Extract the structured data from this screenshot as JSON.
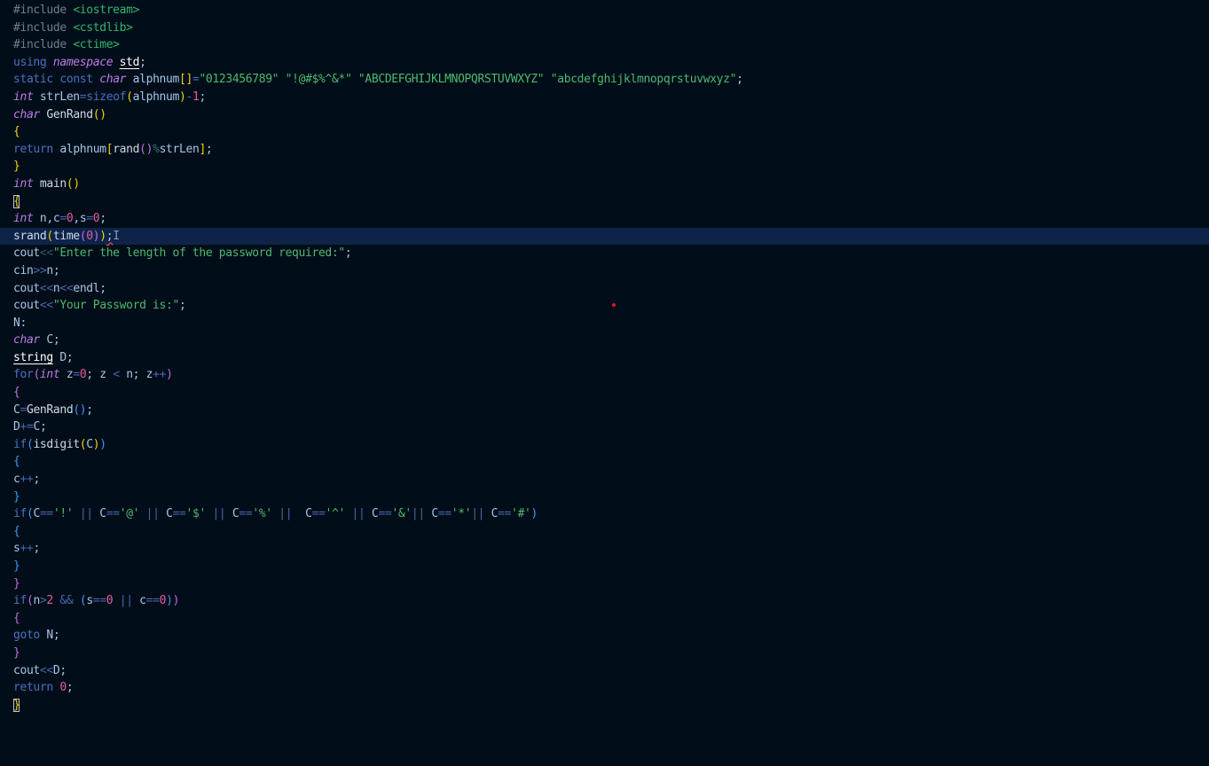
{
  "editor": {
    "current_line": 14,
    "lines": [
      [
        [
          "#include",
          "t-pp"
        ],
        [
          " ",
          ""
        ],
        [
          "<iostream>",
          "t-inc"
        ]
      ],
      [
        [
          "#include",
          "t-pp"
        ],
        [
          " ",
          ""
        ],
        [
          "<cstdlib>",
          "t-inc"
        ]
      ],
      [
        [
          "#include",
          "t-pp"
        ],
        [
          " ",
          ""
        ],
        [
          "<ctime>",
          "t-inc"
        ]
      ],
      [
        [
          "using",
          "t-kw"
        ],
        [
          " ",
          ""
        ],
        [
          "namespace",
          "t-type"
        ],
        [
          " ",
          ""
        ],
        [
          "std",
          "t-ul"
        ],
        [
          ";",
          "t-id"
        ]
      ],
      [
        [
          "static",
          "t-kw"
        ],
        [
          " ",
          ""
        ],
        [
          "const",
          "t-kw"
        ],
        [
          " ",
          ""
        ],
        [
          "char",
          "t-type"
        ],
        [
          " ",
          ""
        ],
        [
          "alphnum",
          "t-id"
        ],
        [
          "[]",
          "t-b1"
        ],
        [
          "=",
          "t-op"
        ],
        [
          "\"0123456789\"",
          "t-str"
        ],
        [
          " ",
          ""
        ],
        [
          "\"!@#$%^&*\"",
          "t-str"
        ],
        [
          " ",
          ""
        ],
        [
          "\"ABCDEFGHIJKLMNOPQRSTUVWXYZ\"",
          "t-str"
        ],
        [
          " ",
          ""
        ],
        [
          "\"abcdefghijklmnopqrstuvwxyz\"",
          "t-str"
        ],
        [
          ";",
          "t-id"
        ]
      ],
      [
        [
          "int",
          "t-type"
        ],
        [
          " ",
          ""
        ],
        [
          "strLen",
          "t-id"
        ],
        [
          "=",
          "t-op"
        ],
        [
          "sizeof",
          "t-kw"
        ],
        [
          "(",
          "t-b1"
        ],
        [
          "alphnum",
          "t-id"
        ],
        [
          ")",
          "t-b1"
        ],
        [
          "-",
          "t-op"
        ],
        [
          "1",
          "t-num"
        ],
        [
          ";",
          "t-id"
        ]
      ],
      [
        [
          "char",
          "t-type"
        ],
        [
          " ",
          ""
        ],
        [
          "GenRand",
          "t-fn"
        ],
        [
          "()",
          "t-b1"
        ]
      ],
      [
        [
          "{",
          "t-b1"
        ]
      ],
      [
        [
          "return",
          "t-kw"
        ],
        [
          " ",
          ""
        ],
        [
          "alphnum",
          "t-id"
        ],
        [
          "[",
          "t-b1"
        ],
        [
          "rand",
          "t-fn"
        ],
        [
          "()",
          "t-b2"
        ],
        [
          "%",
          "t-pct"
        ],
        [
          "strLen",
          "t-id"
        ],
        [
          "]",
          "t-b1"
        ],
        [
          ";",
          "t-id"
        ]
      ],
      [
        [
          "}",
          "t-b1"
        ]
      ],
      [
        [
          "int",
          "t-type"
        ],
        [
          " ",
          ""
        ],
        [
          "main",
          "t-fn"
        ],
        [
          "()",
          "t-b1"
        ]
      ],
      [
        [
          "{",
          "t-bm"
        ]
      ],
      [
        [
          "int",
          "t-type"
        ],
        [
          " ",
          ""
        ],
        [
          "n",
          "t-id"
        ],
        [
          ",",
          "t-id"
        ],
        [
          "c",
          "t-id"
        ],
        [
          "=",
          "t-op"
        ],
        [
          "0",
          "t-num"
        ],
        [
          ",",
          "t-id"
        ],
        [
          "s",
          "t-id"
        ],
        [
          "=",
          "t-op"
        ],
        [
          "0",
          "t-num"
        ],
        [
          ";",
          "t-id"
        ]
      ],
      [
        [
          "srand",
          "t-fn"
        ],
        [
          "(",
          "t-b1"
        ],
        [
          "time",
          "t-fn"
        ],
        [
          "(",
          "t-b2"
        ],
        [
          "0",
          "t-num"
        ],
        [
          ")",
          "t-b2"
        ],
        [
          ")",
          "t-b1"
        ],
        [
          ";",
          "t-id squiggle"
        ],
        [
          "I",
          "t-cursor"
        ]
      ],
      [
        [
          "cout",
          "t-id"
        ],
        [
          "<<",
          "t-dim"
        ],
        [
          "\"Enter the length of the password required:\"",
          "t-str"
        ],
        [
          ";",
          "t-id"
        ]
      ],
      [
        [
          "cin",
          "t-id"
        ],
        [
          ">>",
          "t-op"
        ],
        [
          "n",
          "t-id"
        ],
        [
          ";",
          "t-id"
        ]
      ],
      [
        [
          "cout",
          "t-id"
        ],
        [
          "<<",
          "t-op"
        ],
        [
          "n",
          "t-id"
        ],
        [
          "<<",
          "t-op"
        ],
        [
          "endl",
          "t-id"
        ],
        [
          ";",
          "t-id"
        ]
      ],
      [
        [
          "cout",
          "t-id"
        ],
        [
          "<<",
          "t-op"
        ],
        [
          "\"Your Password is:\"",
          "t-str"
        ],
        [
          ";",
          "t-id"
        ]
      ],
      [
        [
          "N",
          "t-id"
        ],
        [
          ":",
          "t-id"
        ]
      ],
      [
        [
          "char",
          "t-type"
        ],
        [
          " ",
          ""
        ],
        [
          "C",
          "t-id"
        ],
        [
          ";",
          "t-id"
        ]
      ],
      [
        [
          "string",
          "t-ul"
        ],
        [
          " ",
          ""
        ],
        [
          "D",
          "t-id"
        ],
        [
          ";",
          "t-id"
        ]
      ],
      [
        [
          "for",
          "t-kw"
        ],
        [
          "(",
          "t-b2"
        ],
        [
          "int",
          "t-type"
        ],
        [
          " ",
          ""
        ],
        [
          "z",
          "t-id"
        ],
        [
          "=",
          "t-op"
        ],
        [
          "0",
          "t-num"
        ],
        [
          "; ",
          "t-id"
        ],
        [
          "z",
          "t-id"
        ],
        [
          " < ",
          "t-op"
        ],
        [
          "n",
          "t-id"
        ],
        [
          "; ",
          "t-id"
        ],
        [
          "z",
          "t-id"
        ],
        [
          "++",
          "t-op"
        ],
        [
          ")",
          "t-b2"
        ]
      ],
      [
        [
          "{",
          "t-b2"
        ]
      ],
      [
        [
          "C",
          "t-id"
        ],
        [
          "=",
          "t-op"
        ],
        [
          "GenRand",
          "t-fn"
        ],
        [
          "()",
          "t-b3"
        ],
        [
          ";",
          "t-id"
        ]
      ],
      [
        [
          "D",
          "t-id"
        ],
        [
          "+=",
          "t-op"
        ],
        [
          "C",
          "t-id"
        ],
        [
          ";",
          "t-id"
        ]
      ],
      [
        [
          "if",
          "t-kw"
        ],
        [
          "(",
          "t-b3"
        ],
        [
          "isdigit",
          "t-fn"
        ],
        [
          "(",
          "t-b1"
        ],
        [
          "C",
          "t-id"
        ],
        [
          ")",
          "t-b1"
        ],
        [
          ")",
          "t-b3"
        ]
      ],
      [
        [
          "{",
          "t-b3"
        ]
      ],
      [
        [
          "c",
          "t-id"
        ],
        [
          "++",
          "t-op"
        ],
        [
          ";",
          "t-id"
        ]
      ],
      [
        [
          "}",
          "t-b3"
        ]
      ],
      [
        [
          "if",
          "t-kw"
        ],
        [
          "(",
          "t-b3"
        ],
        [
          "C",
          "t-id"
        ],
        [
          "==",
          "t-op"
        ],
        [
          "'!'",
          "t-str"
        ],
        [
          " || ",
          "t-op"
        ],
        [
          "C",
          "t-id"
        ],
        [
          "==",
          "t-op"
        ],
        [
          "'@'",
          "t-str"
        ],
        [
          " || ",
          "t-op"
        ],
        [
          "C",
          "t-id"
        ],
        [
          "==",
          "t-op"
        ],
        [
          "'$'",
          "t-str"
        ],
        [
          " || ",
          "t-op"
        ],
        [
          "C",
          "t-id"
        ],
        [
          "==",
          "t-op"
        ],
        [
          "'%'",
          "t-str"
        ],
        [
          " ||  ",
          "t-op"
        ],
        [
          "C",
          "t-id"
        ],
        [
          "==",
          "t-op"
        ],
        [
          "'^'",
          "t-str"
        ],
        [
          " || ",
          "t-op"
        ],
        [
          "C",
          "t-id"
        ],
        [
          "==",
          "t-op"
        ],
        [
          "'&'",
          "t-str"
        ],
        [
          "|| ",
          "t-op"
        ],
        [
          "C",
          "t-id"
        ],
        [
          "==",
          "t-op"
        ],
        [
          "'*'",
          "t-str"
        ],
        [
          "|| ",
          "t-op"
        ],
        [
          "C",
          "t-id"
        ],
        [
          "==",
          "t-op"
        ],
        [
          "'#'",
          "t-str"
        ],
        [
          ")",
          "t-b3"
        ]
      ],
      [
        [
          "{",
          "t-b3"
        ]
      ],
      [
        [
          "s",
          "t-id"
        ],
        [
          "++",
          "t-op"
        ],
        [
          ";",
          "t-id"
        ]
      ],
      [
        [
          "}",
          "t-b3"
        ]
      ],
      [
        [
          "}",
          "t-b2"
        ]
      ],
      [
        [
          "if",
          "t-kw"
        ],
        [
          "(",
          "t-b2"
        ],
        [
          "n",
          "t-id"
        ],
        [
          ">",
          "t-op"
        ],
        [
          "2",
          "t-num"
        ],
        [
          " && ",
          "t-op"
        ],
        [
          "(",
          "t-b3"
        ],
        [
          "s",
          "t-id"
        ],
        [
          "==",
          "t-op"
        ],
        [
          "0",
          "t-num"
        ],
        [
          " || ",
          "t-op"
        ],
        [
          "c",
          "t-id"
        ],
        [
          "==",
          "t-op"
        ],
        [
          "0",
          "t-num"
        ],
        [
          ")",
          "t-b3"
        ],
        [
          ")",
          "t-b2"
        ]
      ],
      [
        [
          "{",
          "t-b2"
        ]
      ],
      [
        [
          "goto",
          "t-kw"
        ],
        [
          " ",
          ""
        ],
        [
          "N",
          "t-id"
        ],
        [
          ";",
          "t-id"
        ]
      ],
      [
        [
          "}",
          "t-b2"
        ]
      ],
      [
        [
          "cout",
          "t-id"
        ],
        [
          "<<",
          "t-op"
        ],
        [
          "D",
          "t-id"
        ],
        [
          ";",
          "t-id"
        ]
      ],
      [
        [
          "return",
          "t-kw"
        ],
        [
          " ",
          ""
        ],
        [
          "0",
          "t-num"
        ],
        [
          ";",
          "t-id"
        ]
      ],
      [
        [
          "}",
          "t-bm"
        ]
      ]
    ]
  }
}
